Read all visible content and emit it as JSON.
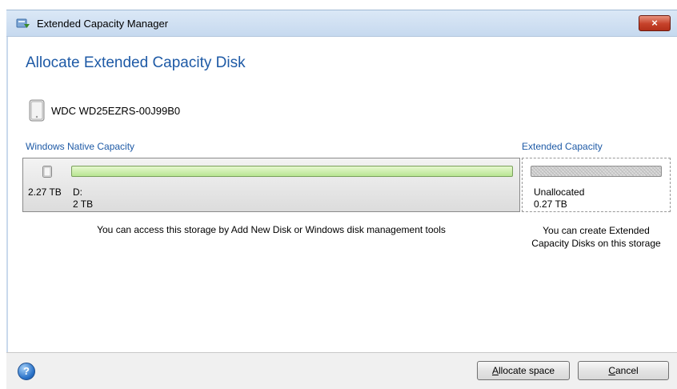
{
  "window": {
    "title": "Extended Capacity Manager",
    "close_glyph": "×",
    "app_icon": "disk-manager-icon"
  },
  "page": {
    "heading": "Allocate Extended Capacity Disk",
    "disk_name": "WDC WD25EZRS-00J99B0"
  },
  "native": {
    "section_title": "Windows Native Capacity",
    "total_size": "2.27 TB",
    "partition_letter": "D:",
    "partition_size": "2 TB",
    "message": "You can access this storage by Add New Disk or Windows disk management tools"
  },
  "extended": {
    "section_title": "Extended Capacity",
    "label": "Unallocated",
    "size": "0.27 TB",
    "message_line1": "You can create Extended",
    "message_line2": "Capacity Disks on this storage"
  },
  "footer": {
    "help_glyph": "?",
    "allocate_label_prefix": "",
    "allocate_label_mnemonic": "A",
    "allocate_label_rest": "llocate space",
    "cancel_label_mnemonic": "C",
    "cancel_label_rest": "ancel"
  },
  "colors": {
    "accent": "#1e5aa6",
    "partition_fill": "#b8e592",
    "unallocated_fill": "#cfcfcf",
    "close_button": "#c5412a"
  }
}
